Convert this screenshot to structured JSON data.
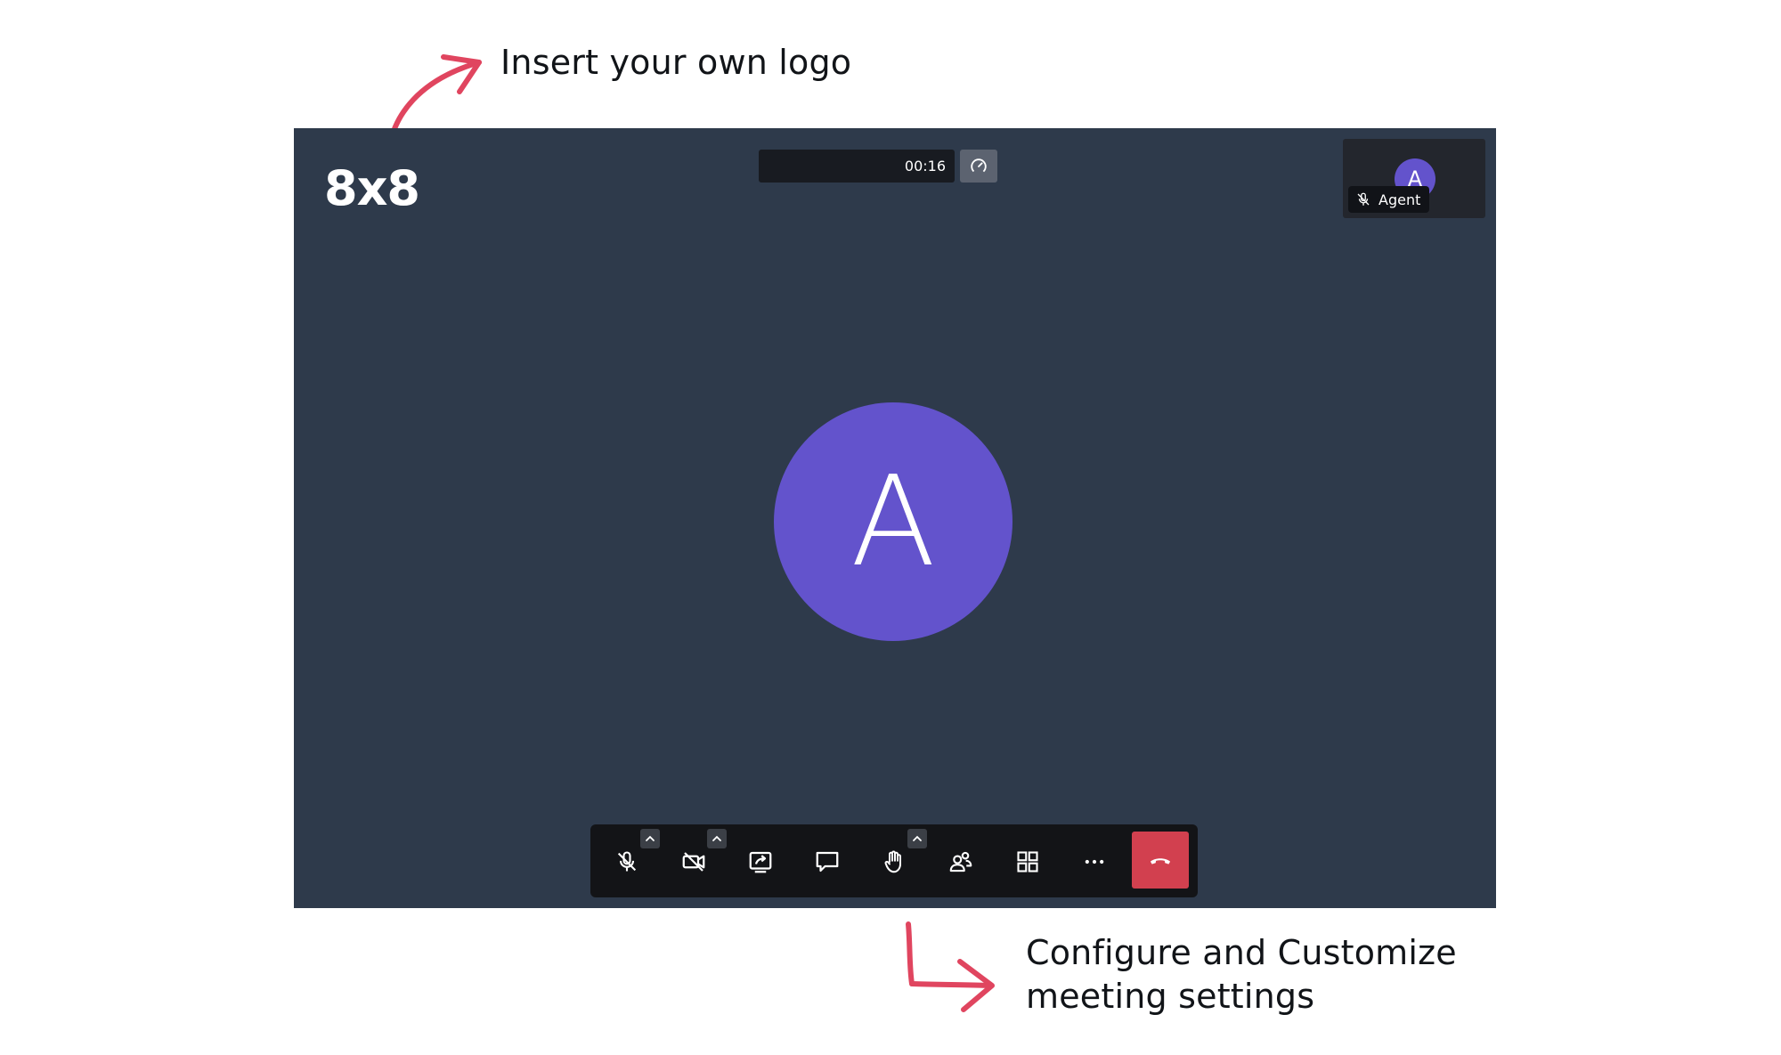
{
  "annotations": {
    "logo_hint": "Insert your own logo",
    "settings_hint_line1": "Configure and Customize",
    "settings_hint_line2": "meeting settings",
    "arrow_color": "#e0455f"
  },
  "meeting": {
    "logo_text": "8x8",
    "timer": "00:16",
    "background_color": "#2e3a4b",
    "avatar_color": "#6353cc",
    "participant": {
      "initial": "A",
      "name": "Agent",
      "muted": true
    },
    "main_avatar_initial": "A"
  },
  "toolbar": {
    "buttons": [
      {
        "name": "microphone",
        "icon": "mic-off-icon",
        "has_options": true
      },
      {
        "name": "camera",
        "icon": "camera-off-icon",
        "has_options": true
      },
      {
        "name": "share-screen",
        "icon": "screen-share-icon",
        "has_options": false
      },
      {
        "name": "chat",
        "icon": "chat-icon",
        "has_options": false
      },
      {
        "name": "raise-hand",
        "icon": "hand-icon",
        "has_options": true
      },
      {
        "name": "participants",
        "icon": "participants-icon",
        "has_options": false
      },
      {
        "name": "tile-view",
        "icon": "grid-icon",
        "has_options": false
      },
      {
        "name": "more",
        "icon": "more-icon",
        "has_options": false
      },
      {
        "name": "hang-up",
        "icon": "phone-hangup-icon",
        "has_options": false
      }
    ],
    "hangup_color": "#d2404f"
  }
}
